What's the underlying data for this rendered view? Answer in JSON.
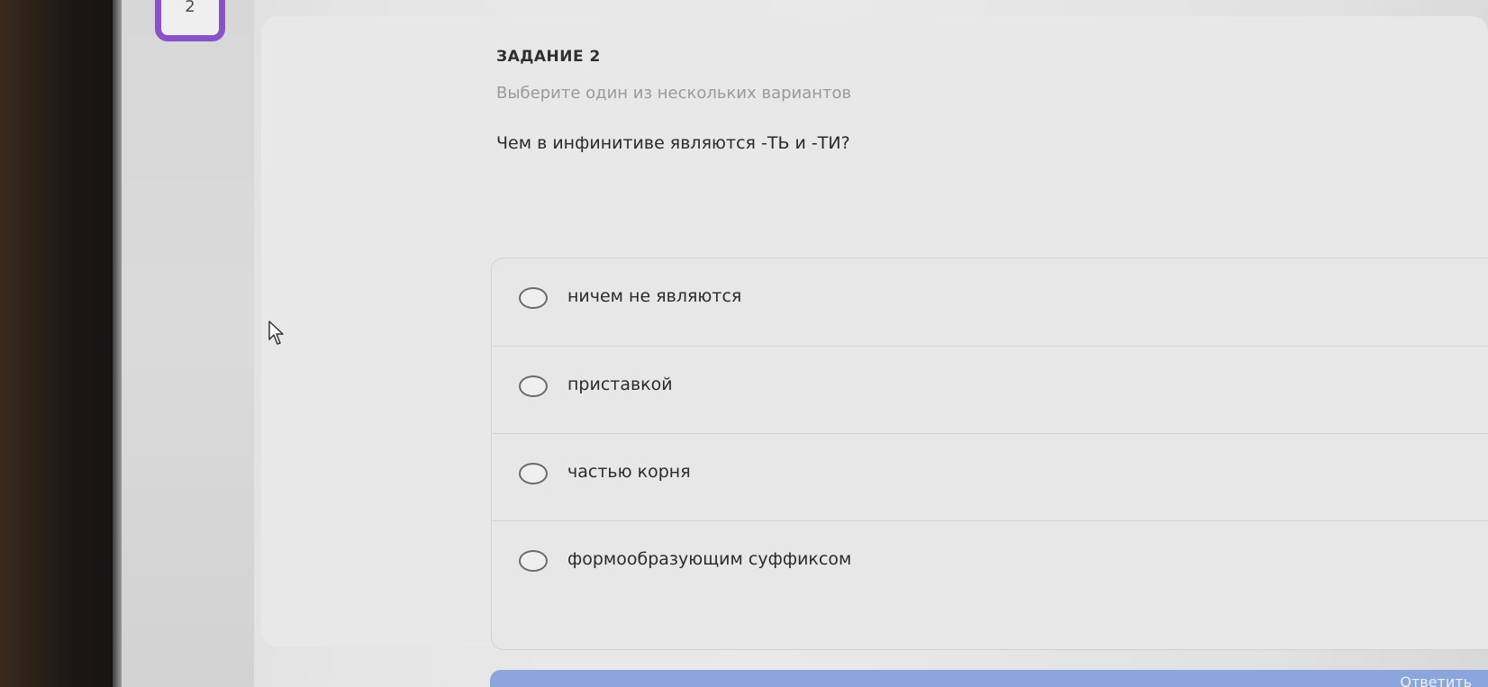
{
  "nav": {
    "current_question": "2"
  },
  "task": {
    "label": "ЗАДАНИЕ 2",
    "instruction": "Выберите один из нескольких вариантов",
    "question": "Чем в инфинитиве являются -ТЬ и -ТИ?"
  },
  "options": [
    {
      "label": "ничем не являются",
      "selected": false
    },
    {
      "label": "приставкой",
      "selected": false
    },
    {
      "label": "частью корня",
      "selected": false
    },
    {
      "label": "формообразующим суффиксом",
      "selected": false
    }
  ],
  "footer": {
    "answer_button_label": "Ответить"
  },
  "colors": {
    "accent_purple": "#8a52c8",
    "answer_button": "#8aa6dc"
  }
}
